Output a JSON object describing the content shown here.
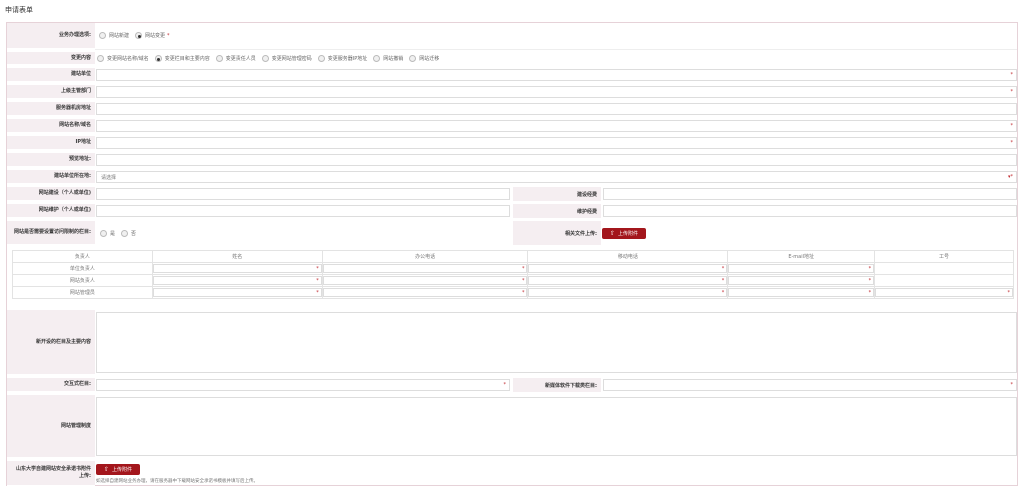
{
  "page_title": "申请表单",
  "business": {
    "label": "业务办理选项:",
    "options": [
      "网站新建",
      "网站变更"
    ],
    "selected": 1
  },
  "change": {
    "label": "变更内容",
    "options": [
      "变更网站名称/域名",
      "变更栏目和主要内容",
      "变更责任人员",
      "变更网站管理密码",
      "变更服务器IP地址",
      "网站撤销",
      "网站迁移"
    ],
    "selected": 1
  },
  "fields": {
    "build_unit": "建站单位",
    "parent_dept": "上级主管部门",
    "server_room": "服务器机房地址",
    "site_name": "网站名称/域名",
    "ip": "IP地址",
    "preview": "预览地址:",
    "location": "建站单位所在地:",
    "location_placeholder": "请选择",
    "site_build": "网站建设（个人或单位)",
    "build_budget": "建设经费",
    "site_maintain": "网站维护（个人或单位)",
    "maintain_budget": "维护经费",
    "access_limit": "网站是否需要设置访问限制的栏目:",
    "access_options": [
      "是",
      "否"
    ],
    "docs_upload": "相关文件上传:",
    "upload_btn": "上传附件"
  },
  "contacts": {
    "headers": [
      "负责人",
      "姓名",
      "办公电话",
      "移动电话",
      "E-mail地址",
      "工号"
    ],
    "rows": [
      "单位负责人",
      "网站负责人",
      "网站管理员"
    ]
  },
  "sections": {
    "new_columns": "新开设的栏目及主要内容",
    "interactive": "交互式栏目:",
    "new_media": "新媒体软件下载类栏目:",
    "mgmt_system": "网站管理制度",
    "commitment": "山东大学自建网站安全承诺书附件上传:",
    "upload_btn": "上传附件",
    "note": "如选择自建网站业务办理，请在服务器中下载网站安全承诺书模板并填写后上传。"
  },
  "colors": {
    "accent": "#a3161c",
    "label_bg": "#f5eef1",
    "required": "#c0272d"
  }
}
